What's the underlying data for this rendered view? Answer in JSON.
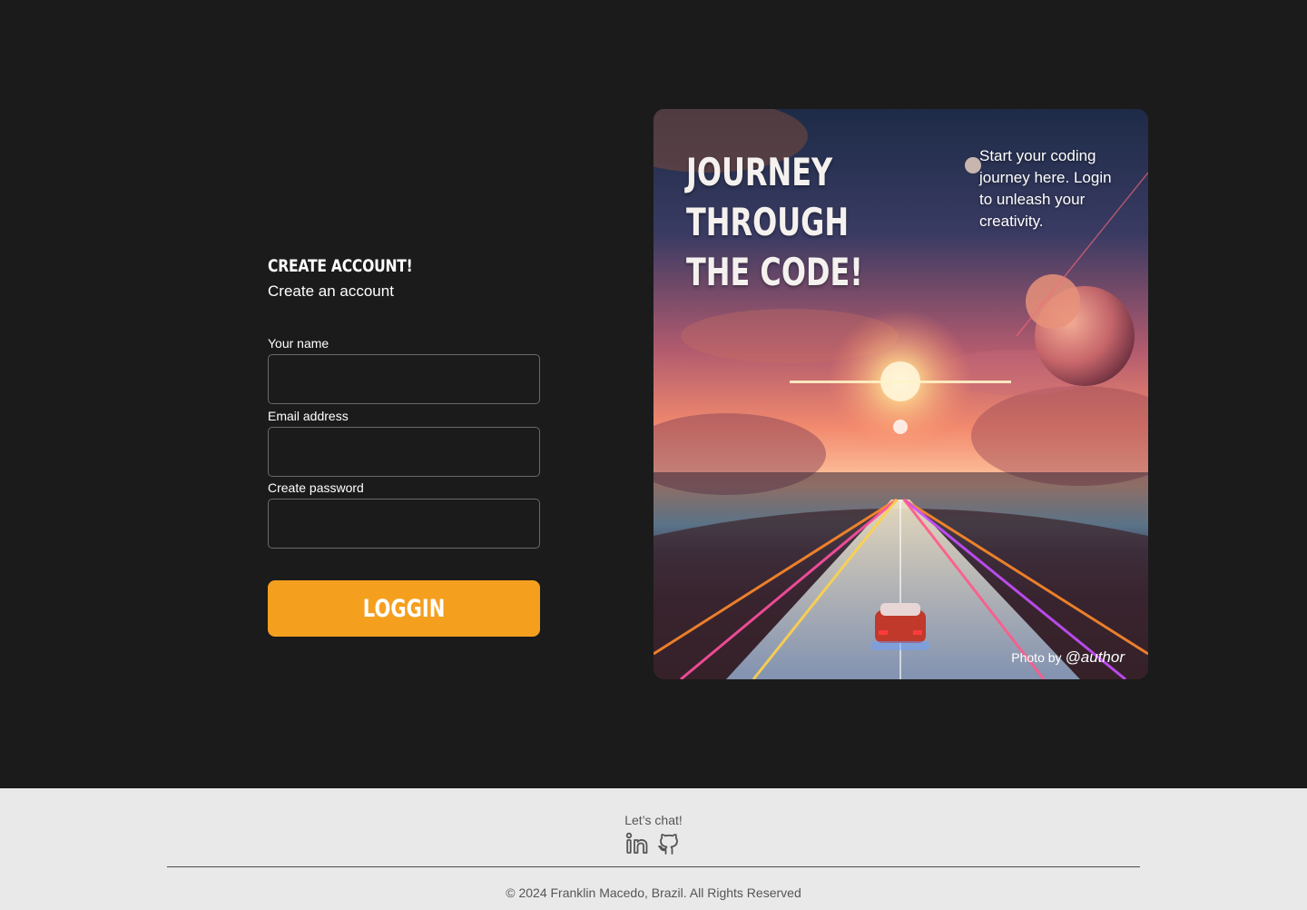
{
  "form": {
    "title": "CREATE ACCOUNT!",
    "subtitle": "Create an account",
    "fields": [
      {
        "label": "Your name",
        "value": "",
        "placeholder": ""
      },
      {
        "label": "Email address",
        "value": "",
        "placeholder": ""
      },
      {
        "label": "Create password",
        "value": "",
        "placeholder": ""
      }
    ],
    "submit_label": "LOGGIN"
  },
  "hero": {
    "title_lines": [
      "JOURNEY",
      "THROUGH",
      "THE CODE!"
    ],
    "tagline": "Start your coding journey here. Login to unleash your creativity.",
    "credit_prefix": "Photo by",
    "credit_author": "@author"
  },
  "footer": {
    "chat_label": "Let’s chat!",
    "social_icons": [
      "linkedin-icon",
      "github-icon"
    ],
    "copyright": "© 2024 Franklin Macedo, Brazil. All Rights Reserved"
  },
  "colors": {
    "background": "#1b1b1b",
    "accent": "#f59f1f",
    "footer_bg": "#e9e9e9"
  }
}
